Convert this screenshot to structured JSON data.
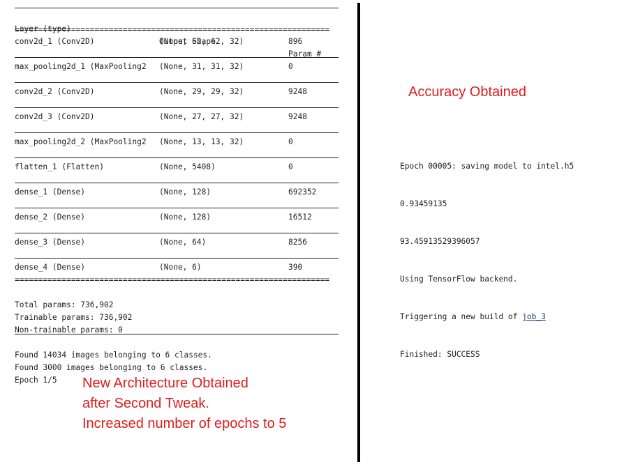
{
  "summary": {
    "headers": [
      "Layer (type)",
      "Output Shape",
      "Param #"
    ],
    "equals_rule": "===================================================================",
    "rows": [
      {
        "layer": "conv2d_1 (Conv2D)",
        "shape": "(None, 62, 62, 32)",
        "params": "896"
      },
      {
        "layer": "max_pooling2d_1 (MaxPooling2",
        "shape": "(None, 31, 31, 32)",
        "params": "0"
      },
      {
        "layer": "conv2d_2 (Conv2D)",
        "shape": "(None, 29, 29, 32)",
        "params": "9248"
      },
      {
        "layer": "conv2d_3 (Conv2D)",
        "shape": "(None, 27, 27, 32)",
        "params": "9248"
      },
      {
        "layer": "max_pooling2d_2 (MaxPooling2",
        "shape": "(None, 13, 13, 32)",
        "params": "0"
      },
      {
        "layer": "flatten_1 (Flatten)",
        "shape": "(None, 5408)",
        "params": "0"
      },
      {
        "layer": "dense_1 (Dense)",
        "shape": "(None, 128)",
        "params": "692352"
      },
      {
        "layer": "dense_2 (Dense)",
        "shape": "(None, 128)",
        "params": "16512"
      },
      {
        "layer": "dense_3 (Dense)",
        "shape": "(None, 64)",
        "params": "8256"
      },
      {
        "layer": "dense_4 (Dense)",
        "shape": "(None, 6)",
        "params": "390"
      }
    ],
    "totals": [
      "Total params: 736,902",
      "Trainable params: 736,902",
      "Non-trainable params: 0"
    ],
    "log": [
      "Found 14034 images belonging to 6 classes.",
      "Found 3000 images belonging to 6 classes.",
      "Epoch 1/5"
    ]
  },
  "annotations": {
    "architecture": "New Architecture Obtained\nafter Second Tweak.\nIncreased number of epochs to 5",
    "accuracy": "Accuracy Obtained"
  },
  "right_log": {
    "lines": [
      "Epoch 00005: saving model to intel.h5",
      "0.93459135",
      "93.45913529396057",
      "Using TensorFlow backend."
    ],
    "trigger_prefix": "Triggering a new build of ",
    "trigger_link": "job_3",
    "finished": "Finished: SUCCESS"
  },
  "colors": {
    "annotation": "#e01b1b",
    "link": "#1a3d7a"
  }
}
